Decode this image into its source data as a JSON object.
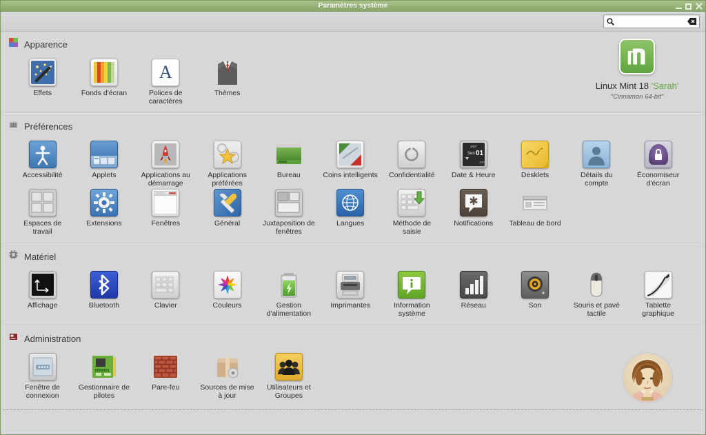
{
  "window": {
    "title": "Paramètres système",
    "controls": {
      "minimize": "minimize-window",
      "maximize": "maximize-window",
      "close": "close-window"
    },
    "accent_titlebar": "#93b074",
    "background": "#d7d7d7"
  },
  "toolbar": {
    "search": {
      "value": "",
      "placeholder": "",
      "search_icon": "search-icon",
      "clear_icon": "clear-backspace-icon"
    }
  },
  "system_info": {
    "logo": "linux-mint-logo",
    "name_prefix": "Linux Mint 18 ",
    "release_codename": "'Sarah'",
    "subtitle": "\"Cinnamon 64-bit\"",
    "codename_color": "#62a544"
  },
  "avatar": {
    "name": "user-avatar",
    "description": "sepia portrait photo"
  },
  "sections": [
    {
      "id": "apparence",
      "title": "Apparence",
      "icon": "appearance-palette-icon",
      "items": [
        {
          "label": "Effets",
          "icon": "effects-icon"
        },
        {
          "label": "Fonds d'écran",
          "icon": "wallpaper-icon"
        },
        {
          "label": "Polices de caractères",
          "icon": "fonts-icon"
        },
        {
          "label": "Thèmes",
          "icon": "themes-icon"
        }
      ]
    },
    {
      "id": "preferences",
      "title": "Préférences",
      "icon": "preferences-book-icon",
      "items": [
        {
          "label": "Accessibilité",
          "icon": "accessibility-icon"
        },
        {
          "label": "Applets",
          "icon": "applets-icon"
        },
        {
          "label": "Applications au démarrage",
          "icon": "startup-applications-icon"
        },
        {
          "label": "Applications préférées",
          "icon": "preferred-applications-icon"
        },
        {
          "label": "Bureau",
          "icon": "desktop-icon"
        },
        {
          "label": "Coins intelligents",
          "icon": "hot-corners-icon"
        },
        {
          "label": "Confidentialité",
          "icon": "privacy-icon"
        },
        {
          "label": "Date & Heure",
          "icon": "date-time-icon"
        },
        {
          "label": "Desklets",
          "icon": "desklets-icon"
        },
        {
          "label": "Détails du compte",
          "icon": "account-details-icon"
        },
        {
          "label": "Économiseur d'écran",
          "icon": "screensaver-lock-icon"
        },
        {
          "label": "Espaces de travail",
          "icon": "workspaces-icon"
        },
        {
          "label": "Extensions",
          "icon": "extensions-gear-icon"
        },
        {
          "label": "Fenêtres",
          "icon": "windows-icon"
        },
        {
          "label": "Général",
          "icon": "general-wrench-icon"
        },
        {
          "label": "Juxtaposition de fenêtres",
          "icon": "window-tiling-icon"
        },
        {
          "label": "Langues",
          "icon": "languages-globe-icon"
        },
        {
          "label": "Méthode de saisie",
          "icon": "input-method-icon"
        },
        {
          "label": "Notifications",
          "icon": "notifications-icon"
        },
        {
          "label": "Tableau de bord",
          "icon": "panel-icon"
        }
      ]
    },
    {
      "id": "materiel",
      "title": "Matériel",
      "icon": "hardware-chip-icon",
      "items": [
        {
          "label": "Affichage",
          "icon": "display-icon"
        },
        {
          "label": "Bluetooth",
          "icon": "bluetooth-icon"
        },
        {
          "label": "Clavier",
          "icon": "keyboard-icon"
        },
        {
          "label": "Couleurs",
          "icon": "color-icon"
        },
        {
          "label": "Gestion d'alimentation",
          "icon": "power-battery-icon"
        },
        {
          "label": "Imprimantes",
          "icon": "printers-icon"
        },
        {
          "label": "Information système",
          "icon": "system-info-icon"
        },
        {
          "label": "Réseau",
          "icon": "network-signal-icon"
        },
        {
          "label": "Son",
          "icon": "sound-speaker-icon"
        },
        {
          "label": "Souris et pavé tactile",
          "icon": "mouse-touchpad-icon"
        },
        {
          "label": "Tablette graphique",
          "icon": "graphics-tablet-icon"
        }
      ]
    },
    {
      "id": "administration",
      "title": "Administration",
      "icon": "administration-icon",
      "items": [
        {
          "label": "Fenêtre de connexion",
          "icon": "login-window-icon"
        },
        {
          "label": "Gestionnaire de pilotes",
          "icon": "driver-manager-icon"
        },
        {
          "label": "Pare-feu",
          "icon": "firewall-brick-icon"
        },
        {
          "label": "Sources de mise à jour",
          "icon": "software-sources-icon"
        },
        {
          "label": "Utilisateurs et Groupes",
          "icon": "users-groups-icon"
        }
      ]
    }
  ]
}
